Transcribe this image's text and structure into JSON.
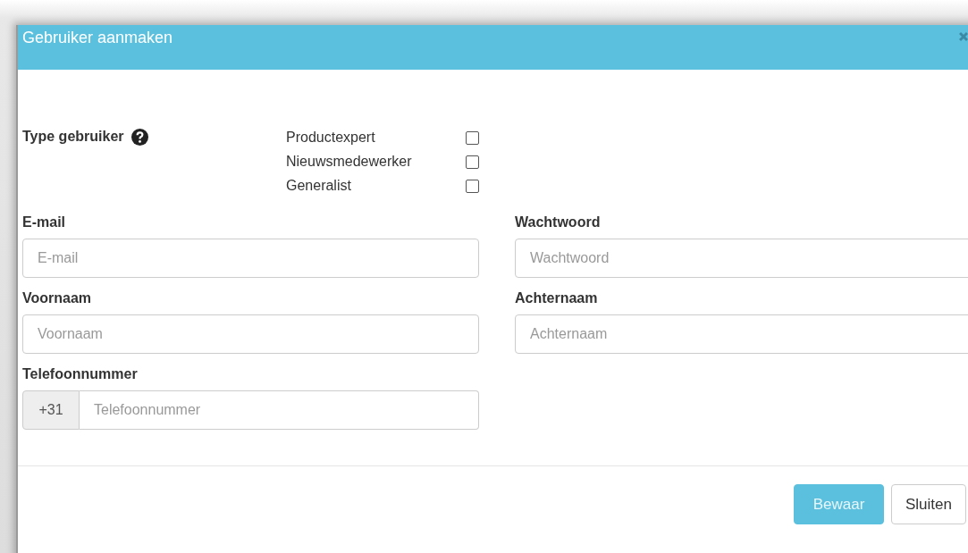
{
  "window": {
    "title": "Gebruiker aanmaken"
  },
  "user_type": {
    "label": "Type gebruiker",
    "options": [
      {
        "label": "Productexpert",
        "checked": false
      },
      {
        "label": "Nieuwsmedewerker",
        "checked": false
      },
      {
        "label": "Generalist",
        "checked": false
      }
    ]
  },
  "fields": [
    {
      "label": "E-mail",
      "placeholder": "E-mail"
    },
    {
      "label": "Wachtwoord",
      "placeholder": "Wachtwoord"
    },
    {
      "label": "Voornaam",
      "placeholder": "Voornaam"
    },
    {
      "label": "Achternaam",
      "placeholder": "Achternaam"
    },
    {
      "label": "Telefoonnummer",
      "placeholder": "Telefoonnummer",
      "prefix": "+31"
    }
  ],
  "buttons": [
    {
      "label": "Bewaar",
      "kind": "primary"
    },
    {
      "label": "Sluiten",
      "kind": "default"
    }
  ]
}
